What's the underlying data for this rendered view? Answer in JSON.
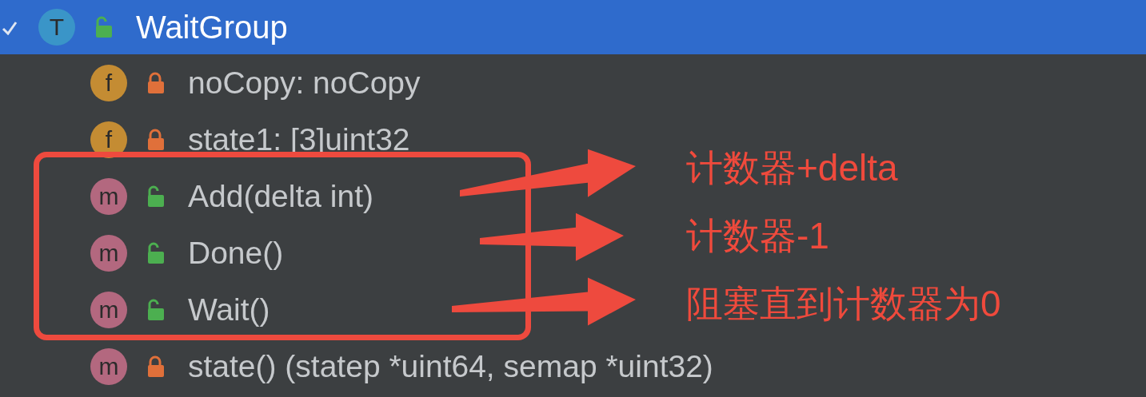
{
  "tree": {
    "badge": "T",
    "kind": "type",
    "locked": false,
    "label": "WaitGroup",
    "selected": true,
    "expanded": true,
    "children": [
      {
        "badge": "f",
        "kind": "field",
        "locked": true,
        "label": "noCopy: noCopy"
      },
      {
        "badge": "f",
        "kind": "field",
        "locked": true,
        "label": "state1: [3]uint32"
      },
      {
        "badge": "m",
        "kind": "method",
        "locked": false,
        "label": "Add(delta int)"
      },
      {
        "badge": "m",
        "kind": "method",
        "locked": false,
        "label": "Done()"
      },
      {
        "badge": "m",
        "kind": "method",
        "locked": false,
        "label": "Wait()"
      },
      {
        "badge": "m",
        "kind": "method",
        "locked": true,
        "label": "state() (statep *uint64, semap *uint32)"
      }
    ]
  },
  "annotations": [
    {
      "text": "计数器+delta"
    },
    {
      "text": "计数器-1"
    },
    {
      "text": "阻塞直到计数器为0"
    }
  ]
}
